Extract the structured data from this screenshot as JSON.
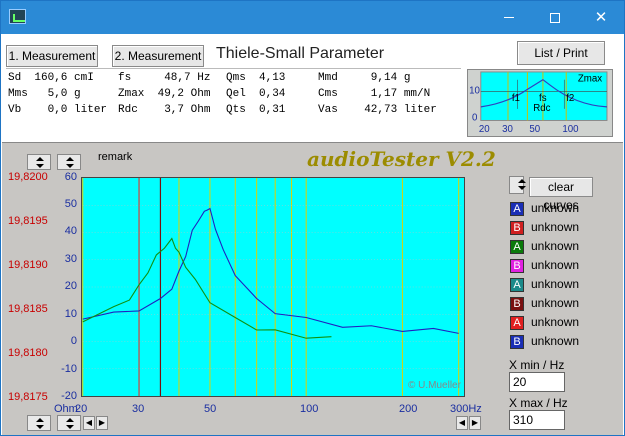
{
  "window": {
    "minimize_label": "",
    "maximize_label": "",
    "close_label": "✕"
  },
  "toolbar": {
    "measurement1": "1. Measurement",
    "measurement2": "2. Measurement",
    "title": "Thiele-Small Parameter",
    "list_print": "List / Print"
  },
  "params": {
    "col1": [
      "Sd  160,6 cmI",
      "Mms   5,0 g",
      "Vb    0,0 liter"
    ],
    "col2": [
      "fs     48,7 Hz",
      "Zmax  49,2 Ohm",
      "Rdc    3,7 Ohm"
    ],
    "col3": [
      "Qms  4,13",
      "Qel  0,34",
      "Qts  0,31"
    ],
    "col4": [
      "Mmd     9,14 g",
      "Cms     1,17 mm/N",
      "Vas    42,73 liter"
    ]
  },
  "thumbnail": {
    "labels": [
      "Zmax",
      "f1",
      "fs",
      "f2",
      "Rdc"
    ],
    "y_ticks": [
      "10",
      "0"
    ],
    "x_ticks": [
      "20",
      "30",
      "50",
      "100"
    ]
  },
  "main": {
    "remark": "remark",
    "brand": "audioTester V2.2",
    "copyright": "© U.Mueller",
    "clear_curves": "clear curves",
    "xmin_label": "X min / Hz",
    "xmin_value": "20",
    "xmax_label": "X max / Hz",
    "xmax_value": "310",
    "y_left_ticks": [
      "19,8200",
      "19,8195",
      "19,8190",
      "19,8185",
      "19,8180",
      "19,8175"
    ],
    "y_right_ticks": [
      "60",
      "50",
      "40",
      "30",
      "20",
      "10",
      "0",
      "-10",
      "-20"
    ],
    "y_unit": "Ohm",
    "x_ticks": [
      "20",
      "30",
      "50",
      "100",
      "200",
      "300Hz"
    ],
    "legend": [
      {
        "letter": "A",
        "label": "unknown",
        "color": "#1a2eb5"
      },
      {
        "letter": "B",
        "label": "unknown",
        "color": "#d02020"
      },
      {
        "letter": "A",
        "label": "unknown",
        "color": "#0a7a0a"
      },
      {
        "letter": "B",
        "label": "unknown",
        "color": "#e020e0"
      },
      {
        "letter": "A",
        "label": "unknown",
        "color": "#1a8a8a"
      },
      {
        "letter": "B",
        "label": "unknown",
        "color": "#7a1010"
      },
      {
        "letter": "A",
        "label": "unknown",
        "color": "#e02020"
      },
      {
        "letter": "B",
        "label": "unknown",
        "color": "#1a2eb5"
      }
    ]
  },
  "chart_data": {
    "type": "line",
    "xlabel": "",
    "ylabel": "Ohm",
    "x_scale": "log",
    "xlim": [
      20,
      310
    ],
    "ylim": [
      -20,
      60
    ],
    "grid": true,
    "series": [
      {
        "color": "#2020c0",
        "x": [
          20,
          25,
          30,
          35,
          38,
          40,
          42,
          44,
          46,
          48,
          49,
          50,
          52,
          55,
          60,
          70,
          80,
          100,
          130,
          160,
          200,
          250,
          300
        ],
        "y": [
          9,
          10,
          12,
          15,
          20,
          25,
          32,
          40,
          45,
          47,
          49,
          48,
          42,
          33,
          25,
          15,
          11,
          8,
          6,
          5,
          4.5,
          4,
          3.8
        ]
      },
      {
        "color": "#109010",
        "x": [
          20,
          25,
          28,
          30,
          32,
          34,
          36,
          38,
          39,
          40,
          42,
          45,
          50,
          60,
          70,
          80,
          100,
          120
        ],
        "y": [
          8,
          12,
          16,
          20,
          26,
          31,
          35,
          37,
          35,
          32,
          28,
          22,
          15,
          8,
          5,
          3.5,
          2,
          1
        ]
      }
    ],
    "markers": [
      {
        "x": 30,
        "color": "#d04040"
      },
      {
        "x": 35,
        "color": "#7a1010"
      }
    ]
  }
}
